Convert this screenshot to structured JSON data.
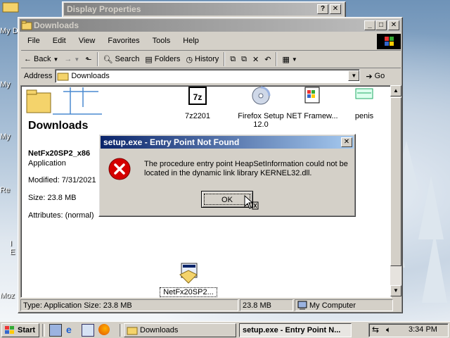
{
  "desktop": {
    "icon_labels": [
      "My D",
      "My",
      "My",
      "Re",
      "I",
      "E",
      "Moz"
    ]
  },
  "display_properties": {
    "title": "Display Properties",
    "help_button": "?",
    "close_button": "✕"
  },
  "explorer": {
    "title": "Downloads",
    "menu": [
      "File",
      "Edit",
      "View",
      "Favorites",
      "Tools",
      "Help"
    ],
    "toolbar": {
      "back": "Back",
      "search": "Search",
      "folders": "Folders",
      "history": "History"
    },
    "address": {
      "label": "Address",
      "value": "Downloads",
      "go": "Go"
    },
    "left_panel": {
      "folder_title": "Downloads",
      "selected_name": "NetFx20SP2_x86",
      "selected_type": "Application",
      "modified": "Modified: 7/31/2021",
      "size": "Size: 23.8 MB",
      "attributes": "Attributes: (normal)"
    },
    "files": [
      {
        "name": "7z2201",
        "icon": "7zip-icon"
      },
      {
        "name": "Firefox Setup 12.0",
        "icon": "cd-install-icon"
      },
      {
        "name": "NET Framew...",
        "icon": "dotnet-installer-icon"
      },
      {
        "name": "penis",
        "icon": "setup-icon"
      },
      {
        "name": "NetFx20SP2...",
        "icon": "installer-icon"
      }
    ],
    "status": {
      "type_info": "Type: Application Size: 23.8 MB",
      "size": "23.8 MB",
      "zone": "My Computer"
    }
  },
  "dialog": {
    "title": "setup.exe - Entry Point Not Found",
    "message_line1": "The procedure entry point HeapSetInformation could not be",
    "message_line2": "located in the dynamic link library KERNEL32.dll.",
    "ok_label": "OK"
  },
  "taskbar": {
    "start_label": "Start",
    "tasks": [
      {
        "label": "Downloads",
        "active": false
      },
      {
        "label": "setup.exe - Entry Point N...",
        "active": true
      }
    ],
    "clock": "3:34 PM"
  },
  "colors": {
    "title_active": "#0a246a",
    "title_gradient_end": "#a6caf0",
    "face": "#d4d0c8",
    "error_red": "#d40000"
  }
}
